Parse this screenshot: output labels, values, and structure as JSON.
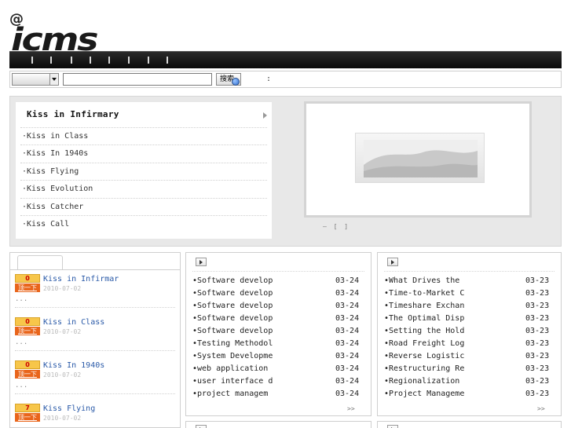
{
  "brand": {
    "at": "@",
    "word": "icms"
  },
  "search": {
    "button_label": "搜索",
    "colon": ":"
  },
  "slideshow": {
    "title": "Kiss in Infirmary",
    "items": [
      "·Kiss in Class",
      "·Kiss In 1940s",
      "·Kiss Flying",
      "·Kiss Evolution",
      "·Kiss Catcher",
      "·Kiss Call"
    ],
    "pager": "— [ ]"
  },
  "rank": {
    "up_label": "顶一下",
    "items": [
      {
        "count": "0",
        "title": "Kiss in Infirmar",
        "date": "2010-07-02",
        "ellipsis": "..."
      },
      {
        "count": "0",
        "title": "Kiss in Class",
        "date": "2010-07-02",
        "ellipsis": "..."
      },
      {
        "count": "0",
        "title": "Kiss In 1940s",
        "date": "2010-07-02",
        "ellipsis": "..."
      },
      {
        "count": "7",
        "title": "Kiss Flying",
        "date": "2010-07-02",
        "ellipsis": ""
      }
    ]
  },
  "news_left": {
    "rows": [
      {
        "title": "Software develop",
        "date": "03-24"
      },
      {
        "title": "Software develop",
        "date": "03-24"
      },
      {
        "title": "Software develop",
        "date": "03-24"
      },
      {
        "title": "Software develop",
        "date": "03-24"
      },
      {
        "title": "Software develop",
        "date": "03-24"
      },
      {
        "title": "Testing Methodol",
        "date": "03-24"
      },
      {
        "title": "System Developme",
        "date": "03-24"
      },
      {
        "title": "web application",
        "date": "03-24"
      },
      {
        "title": "user interface d",
        "date": "03-24"
      },
      {
        "title": "project managem",
        "date": "03-24"
      }
    ],
    "more": ">>"
  },
  "news_right": {
    "rows": [
      {
        "title": "What Drives the",
        "date": "03-23"
      },
      {
        "title": "Time-to-Market C",
        "date": "03-23"
      },
      {
        "title": "Timeshare Exchan",
        "date": "03-23"
      },
      {
        "title": "The Optimal Disp",
        "date": "03-23"
      },
      {
        "title": "Setting the Hold",
        "date": "03-23"
      },
      {
        "title": "Road Freight Log",
        "date": "03-23"
      },
      {
        "title": "Reverse Logistic",
        "date": "03-23"
      },
      {
        "title": "Restructuring Re",
        "date": "03-23"
      },
      {
        "title": "Regionalization",
        "date": "03-23"
      },
      {
        "title": "Project Manageme",
        "date": "03-23"
      }
    ],
    "more": ">>"
  },
  "bullet": "•"
}
